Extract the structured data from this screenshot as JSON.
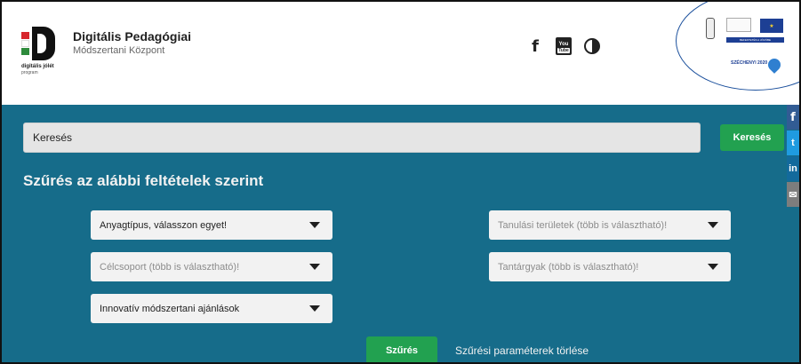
{
  "header": {
    "logo": {
      "line1": "digitális jólét",
      "line2": "program"
    },
    "brand_title": "Digitális Pedagógiai",
    "brand_subtitle": "Módszertani Központ",
    "social": {
      "facebook_glyph": "f",
      "youtube_you": "You",
      "youtube_tube": "Tube"
    },
    "eu_badge": {
      "strip_text": "BEFEKTETÉS A JÖVŐBE",
      "szechenyi": "SZÉCHENYI 2020"
    }
  },
  "search": {
    "placeholder": "Keresés",
    "button_label": "Keresés"
  },
  "filters": {
    "title": "Szűrés az alábbi feltételek szerint",
    "material_type": "Anyagtípus, válasszon egyet!",
    "target_group": "Célcsoport  (több is választható)!",
    "innovative": "Innovatív módszertani ajánlások",
    "learning_areas": "Tanulási területek (több is választható)!",
    "subjects": "Tantárgyak (több is választható)!",
    "filter_button": "Szűrés",
    "clear_link": "Szűrési paraméterek törlése"
  },
  "share_rail": {
    "facebook": "f",
    "twitter": "t",
    "linkedin": "in",
    "mail": "✉"
  },
  "colors": {
    "main_bg": "#166c8a",
    "accent_green": "#22a150"
  }
}
